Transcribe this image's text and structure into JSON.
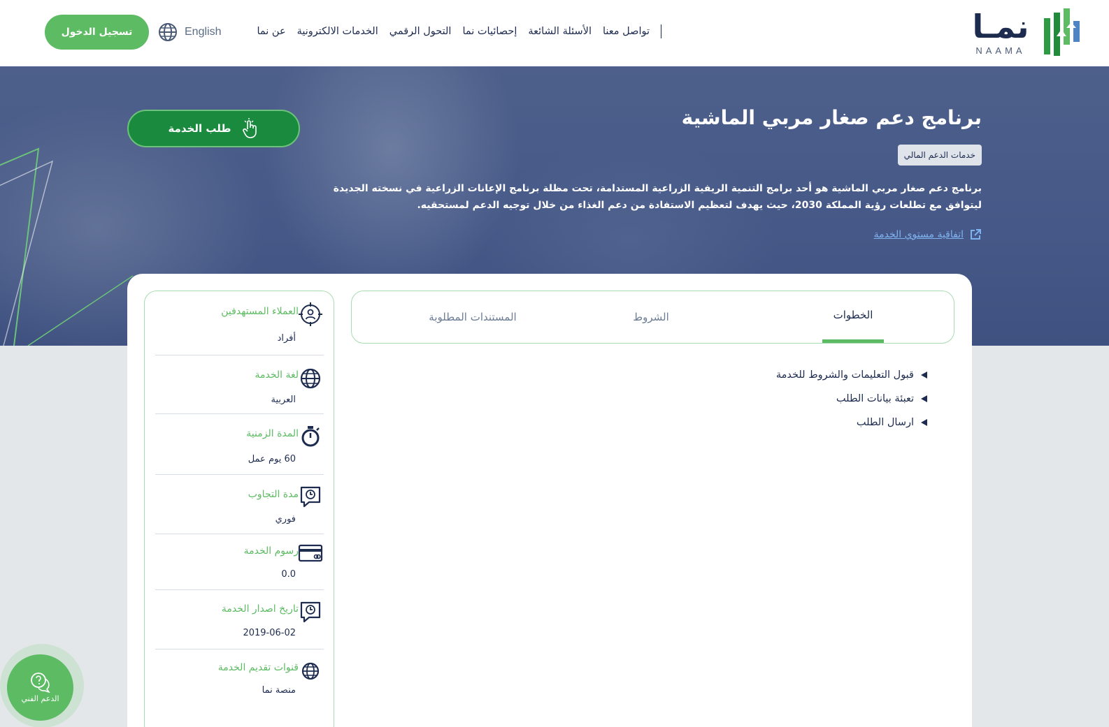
{
  "header": {
    "logo_arabic": "نمـا",
    "logo_latin": "NAAMA",
    "nav": [
      "عن نما",
      "الخدمات الالكترونية",
      "التحول الرقمي",
      "إحصائيات نما",
      "الأسئلة الشائعة",
      "تواصل معنا"
    ],
    "language_label": "English",
    "login_label": "تسجيل الدخول"
  },
  "hero": {
    "title": "برنامج دعم صغار مربي الماشية",
    "badge": "خدمات الدعم المالي",
    "description": "برنامج دعم صغار مربي الماشية هو أحد برامج التنمية الريفية الزراعية المستدامة، تحت مظلة برنامج الإعانات الزراعية في نسخته الجديدة ليتوافق مع تطلعات رؤية المملكة 2030، حيث يهدف لتعظيم الاستفادة من دعم الغذاء من خلال توجيه الدعم لمستحقيه.",
    "sla_link": "اتفاقية مستوي الخدمة",
    "request_button": "طلب الخدمة"
  },
  "tabs": [
    {
      "label": "الخطوات",
      "active": true
    },
    {
      "label": "الشروط",
      "active": false
    },
    {
      "label": "المستندات المطلوبة",
      "active": false
    }
  ],
  "steps": [
    "قبول التعليمات والشروط للخدمة",
    "تعبئة بيانات الطلب",
    "ارسال الطلب"
  ],
  "info": {
    "target_customers": {
      "label": "العملاء المستهدفين",
      "value": "أفراد"
    },
    "service_language": {
      "label": "لغة الخدمة",
      "value": "العربية"
    },
    "duration": {
      "label": "المدة الزمنية",
      "value": "60 يوم عمل"
    },
    "response_time": {
      "label": "مدة التجاوب",
      "value": "فوري"
    },
    "fees": {
      "label": "رسوم الخدمة",
      "value": "0.0"
    },
    "release_date": {
      "label": "تاريخ اصدار الخدمة",
      "value": "2019-06-02"
    },
    "channels": {
      "label": "قنوات تقديم الخدمة",
      "value": "منصة نما"
    }
  },
  "support": {
    "label": "الدعم الفني"
  },
  "colors": {
    "brand_green": "#5dbb63",
    "dark_green": "#1a8a3e",
    "navy": "#1d2b4f",
    "link_blue": "#7fb3f0"
  },
  "icons": [
    "globe-icon",
    "hand-pointer-icon",
    "external-link-icon",
    "target-user-icon",
    "language-globe-icon",
    "stopwatch-icon",
    "chat-clock-icon",
    "credit-card-icon",
    "calendar-chat-icon",
    "network-globe-icon",
    "help-chat-icon"
  ]
}
